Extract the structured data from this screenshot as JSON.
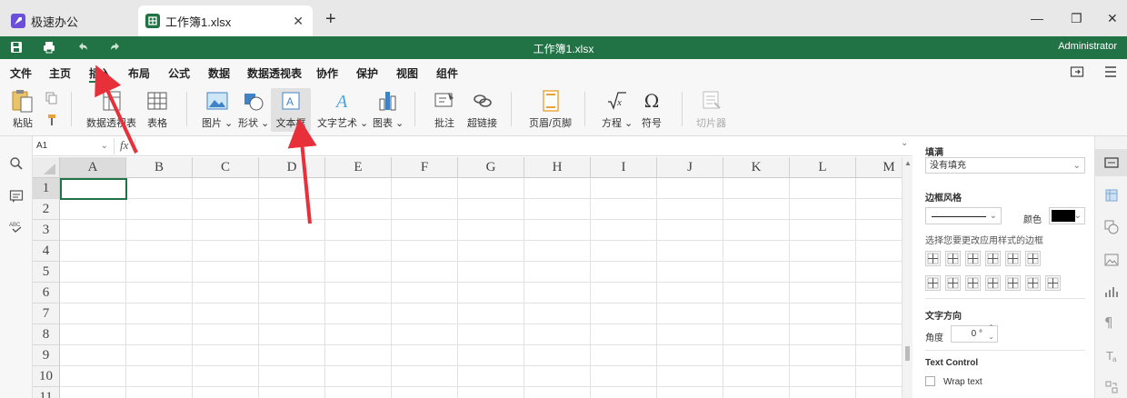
{
  "tabs": [
    {
      "label": "极速办公",
      "icon": "rocket-icon"
    },
    {
      "label": "工作簿1.xlsx",
      "icon": "spreadsheet-icon"
    }
  ],
  "window": {
    "title": "工作簿1.xlsx",
    "user": "Administrator"
  },
  "colors": {
    "brand_green": "#217346",
    "annotation_red": "#e8303a"
  },
  "menu": [
    "文件",
    "主页",
    "插入",
    "布局",
    "公式",
    "数据",
    "数据透视表",
    "协作",
    "保护",
    "视图",
    "组件"
  ],
  "active_menu": "插入",
  "toolbar": {
    "paste": "粘贴",
    "pivot": "数据透视表",
    "table": "表格",
    "image": "图片",
    "shape": "形状",
    "textbox": "文本框",
    "wordart": "文字艺术",
    "chart": "图表",
    "comment": "批注",
    "hyperlink": "超链接",
    "headerfooter": "页眉/页脚",
    "equation": "方程",
    "symbol": "符号",
    "slicer": "切片器"
  },
  "formula_bar": {
    "cell_ref": "A1",
    "fx": "fx",
    "value": ""
  },
  "columns": [
    "A",
    "B",
    "C",
    "D",
    "E",
    "F",
    "G",
    "H",
    "I",
    "J",
    "K",
    "L",
    "M"
  ],
  "rows": [
    "1",
    "2",
    "3",
    "4",
    "5",
    "6",
    "7",
    "8",
    "9",
    "10",
    "11"
  ],
  "selected_cell": "A1",
  "panel": {
    "fill_title": "填满",
    "fill_value": "没有填充",
    "border_title": "边框风格",
    "color_label": "颜色",
    "border_color": "#000000",
    "border_hint": "选择您要更改应用样式的边框",
    "text_dir_title": "文字方向",
    "angle_label": "角度",
    "angle_value": "0 °",
    "text_control_title": "Text Control",
    "wrap_text": "Wrap text"
  }
}
